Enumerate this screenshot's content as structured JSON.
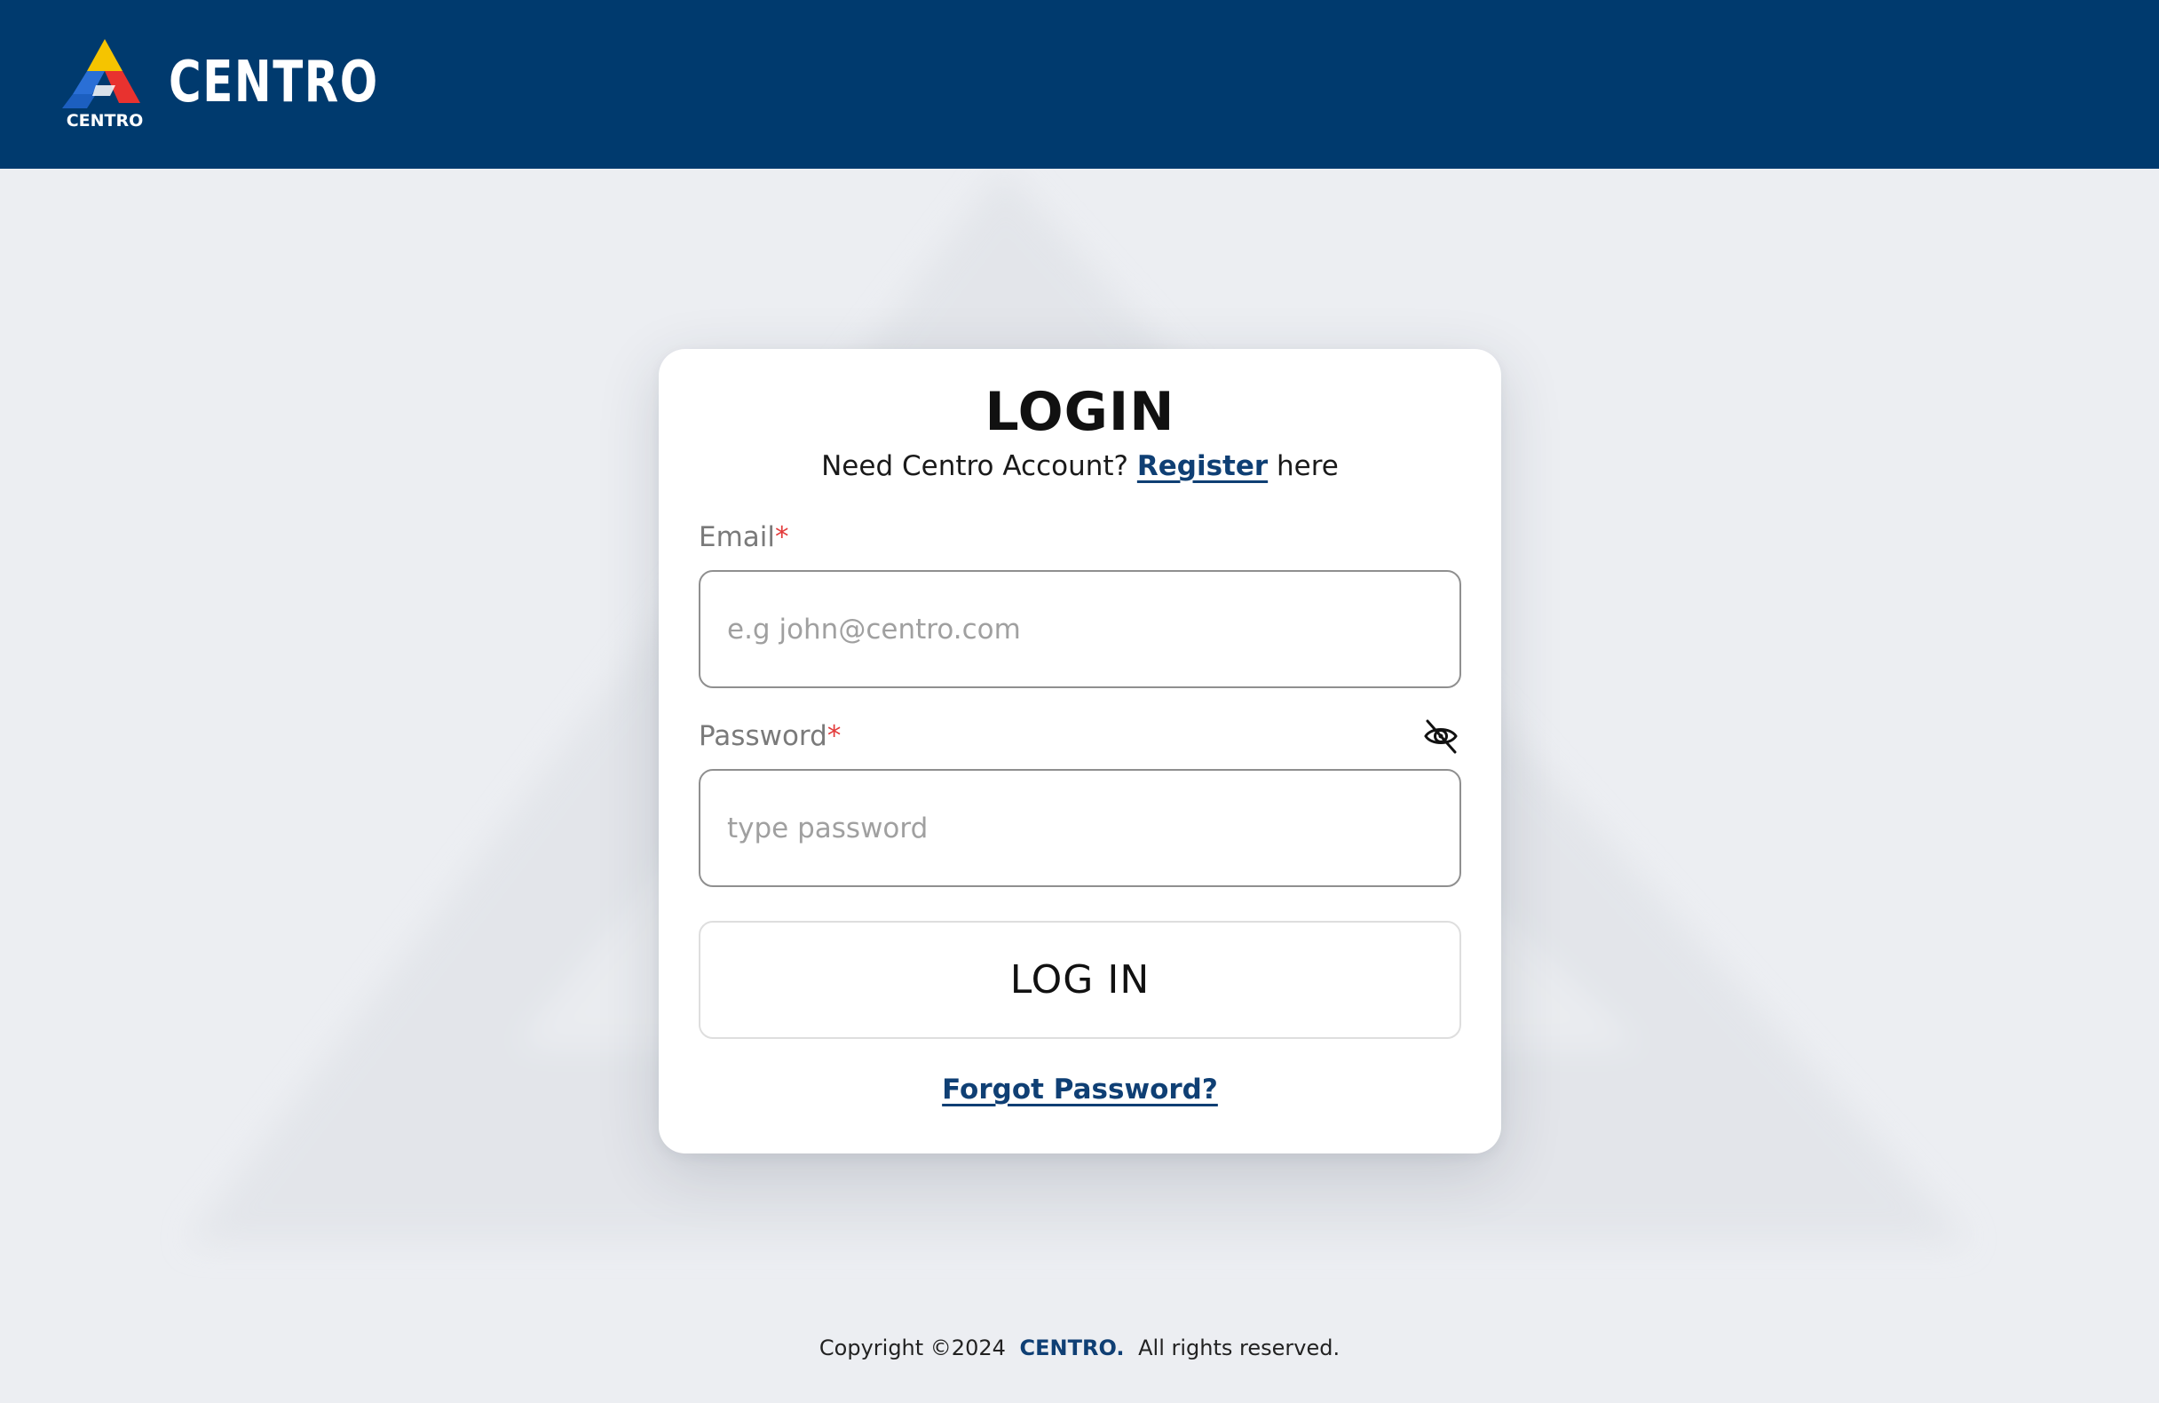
{
  "header": {
    "logo_caption": "CENTRO",
    "brand_name": "CENTRO"
  },
  "login": {
    "title": "LOGIN",
    "register_prefix": "Need Centro Account?",
    "register_link": "Register",
    "register_suffix": "here",
    "email_label": "Email",
    "email_placeholder": "e.g john@centro.com",
    "email_value": "",
    "password_label": "Password",
    "password_placeholder": "type password",
    "password_value": "",
    "required_mark": "*",
    "submit_label": "LOG IN",
    "forgot_link": "Forgot Password?"
  },
  "footer": {
    "copyright": "Copyright ©2024",
    "brand": "CENTRO.",
    "rights": "All rights reserved."
  },
  "icons": {
    "password_toggle": "eye-slash-icon",
    "logo": "centro-triangle-logo"
  },
  "colors": {
    "header_bg": "#003a6e",
    "link": "#0f3f74",
    "required": "#e33a3a",
    "page_bg": "#eceef2"
  }
}
